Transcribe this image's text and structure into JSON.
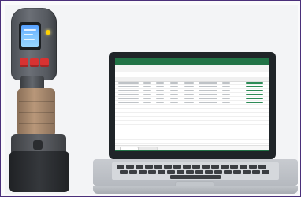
{
  "scene": {
    "description_tags": [
      "handheld-device",
      "laptop",
      "spreadsheet"
    ],
    "colors": {
      "frame_border": "#4a2f7a",
      "background": "#f3f4f6",
      "excel_green": "#217346",
      "device_body": "#5d6167",
      "device_handle": "#b89779",
      "device_buttons": "#d83232",
      "device_screen": "#7cc1ff",
      "laptop_bezel": "#1f2428",
      "laptop_deck": "#c8cbd0"
    },
    "icons": {
      "device": "handheld-scanner-icon",
      "laptop": "laptop-icon",
      "spreadsheet": "spreadsheet-icon"
    }
  }
}
